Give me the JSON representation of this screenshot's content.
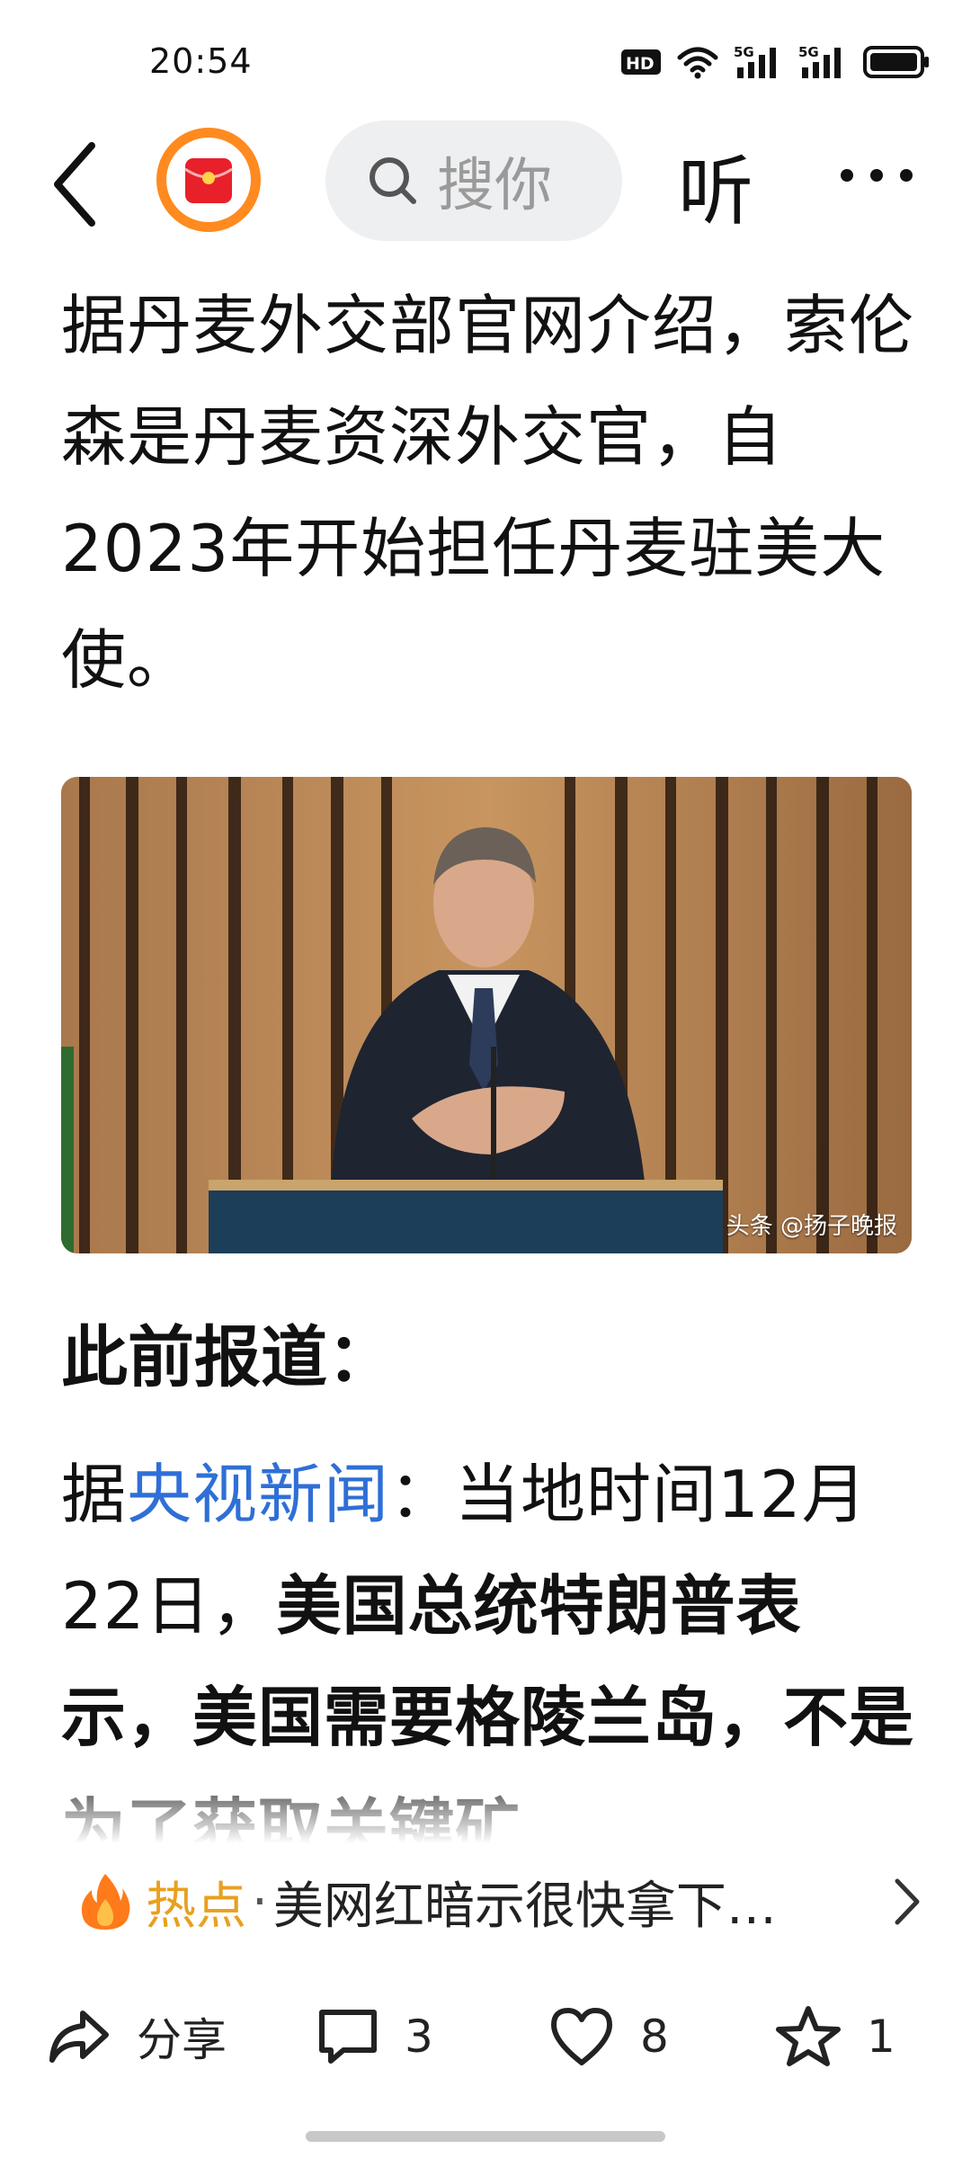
{
  "status_bar": {
    "time": "20:54",
    "icons": [
      "hd-icon",
      "wifi-icon",
      "signal-5g-icon",
      "signal-5g-icon",
      "battery-icon"
    ],
    "hd_label": "HD",
    "net_label_1": "5G",
    "net_label_2": "5G"
  },
  "header": {
    "back_icon": "chevron-left-icon",
    "logo_icon": "red-envelope-logo-icon",
    "search_placeholder": "搜你",
    "listen_label": "听",
    "more_icon": "more-dots-icon"
  },
  "article": {
    "paragraph_1": "据丹麦外交部官网介绍，索伦森是丹麦资深外交官，自2023年开始担任丹麦驻美大使。",
    "image": {
      "description_icon": "speaker-at-podium-photo",
      "watermark": "头条 @扬子晚报"
    },
    "section_heading": "此前报道：",
    "paragraph_2_prefix": "据",
    "paragraph_2_link": "央视新闻",
    "paragraph_2_colon": "：当地时间12月22日，",
    "paragraph_2_bold": "美国总统特朗普表示，美国需要格陵兰岛，不是为了获取关键矿"
  },
  "hot_bar": {
    "icon": "flame-icon",
    "label": "热点",
    "separator": "·",
    "text": "美网红暗示很快拿下…"
  },
  "actions": {
    "share": {
      "icon": "share-icon",
      "label": "分享"
    },
    "comment": {
      "icon": "comment-icon",
      "count": "3"
    },
    "like": {
      "icon": "heart-icon",
      "count": "8"
    },
    "favorite": {
      "icon": "star-icon",
      "count": "1"
    }
  },
  "colors": {
    "link": "#2f6fd6",
    "hot_label": "#e8a020",
    "logo_orange": "#ff8a1f",
    "logo_red": "#e8202a"
  }
}
